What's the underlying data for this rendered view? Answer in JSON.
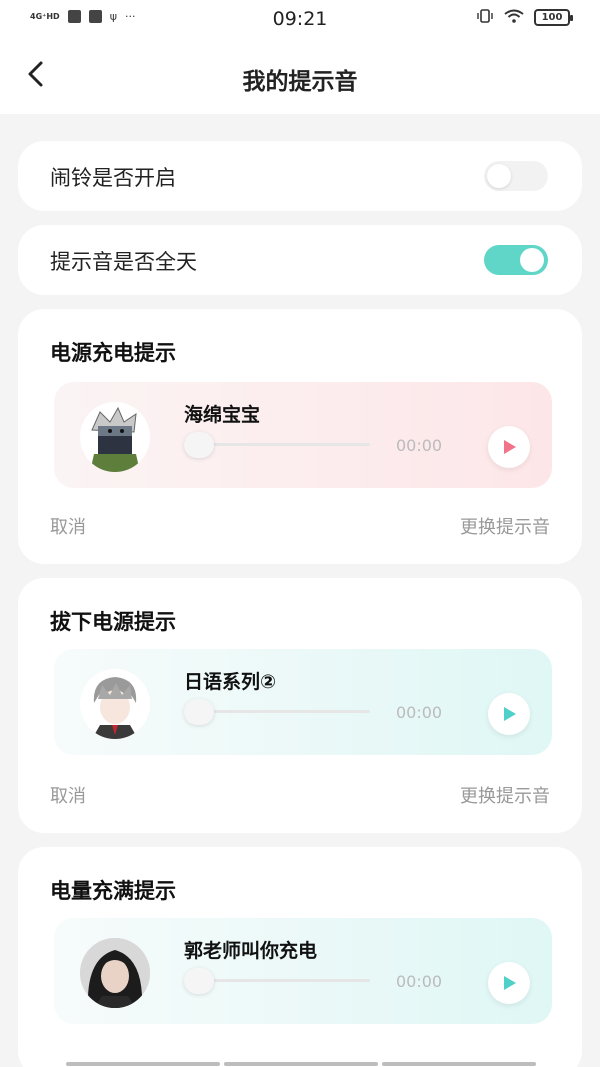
{
  "status_bar": {
    "network": "4G⁺HD",
    "time": "09:21",
    "battery": "100",
    "dots": "···"
  },
  "header": {
    "title": "我的提示音"
  },
  "settings": {
    "alarm": {
      "label": "闹铃是否开启",
      "enabled": false
    },
    "all_day": {
      "label": "提示音是否全天",
      "enabled": true
    }
  },
  "sections": [
    {
      "title": "电源充电提示",
      "track": "海绵宝宝",
      "time": "00:00",
      "cancel": "取消",
      "change": "更换提示音",
      "theme": "pink",
      "play_color": "#f0738a"
    },
    {
      "title": "拔下电源提示",
      "track": "日语系列②",
      "time": "00:00",
      "cancel": "取消",
      "change": "更换提示音",
      "theme": "cyan",
      "play_color": "#4fd0c8"
    },
    {
      "title": "电量充满提示",
      "track": "郭老师叫你充电",
      "time": "00:00",
      "theme": "cyan",
      "play_color": "#4fd0c8"
    }
  ],
  "colors": {
    "toggle_on": "#5fd6c8",
    "background": "#f4f4f4"
  }
}
